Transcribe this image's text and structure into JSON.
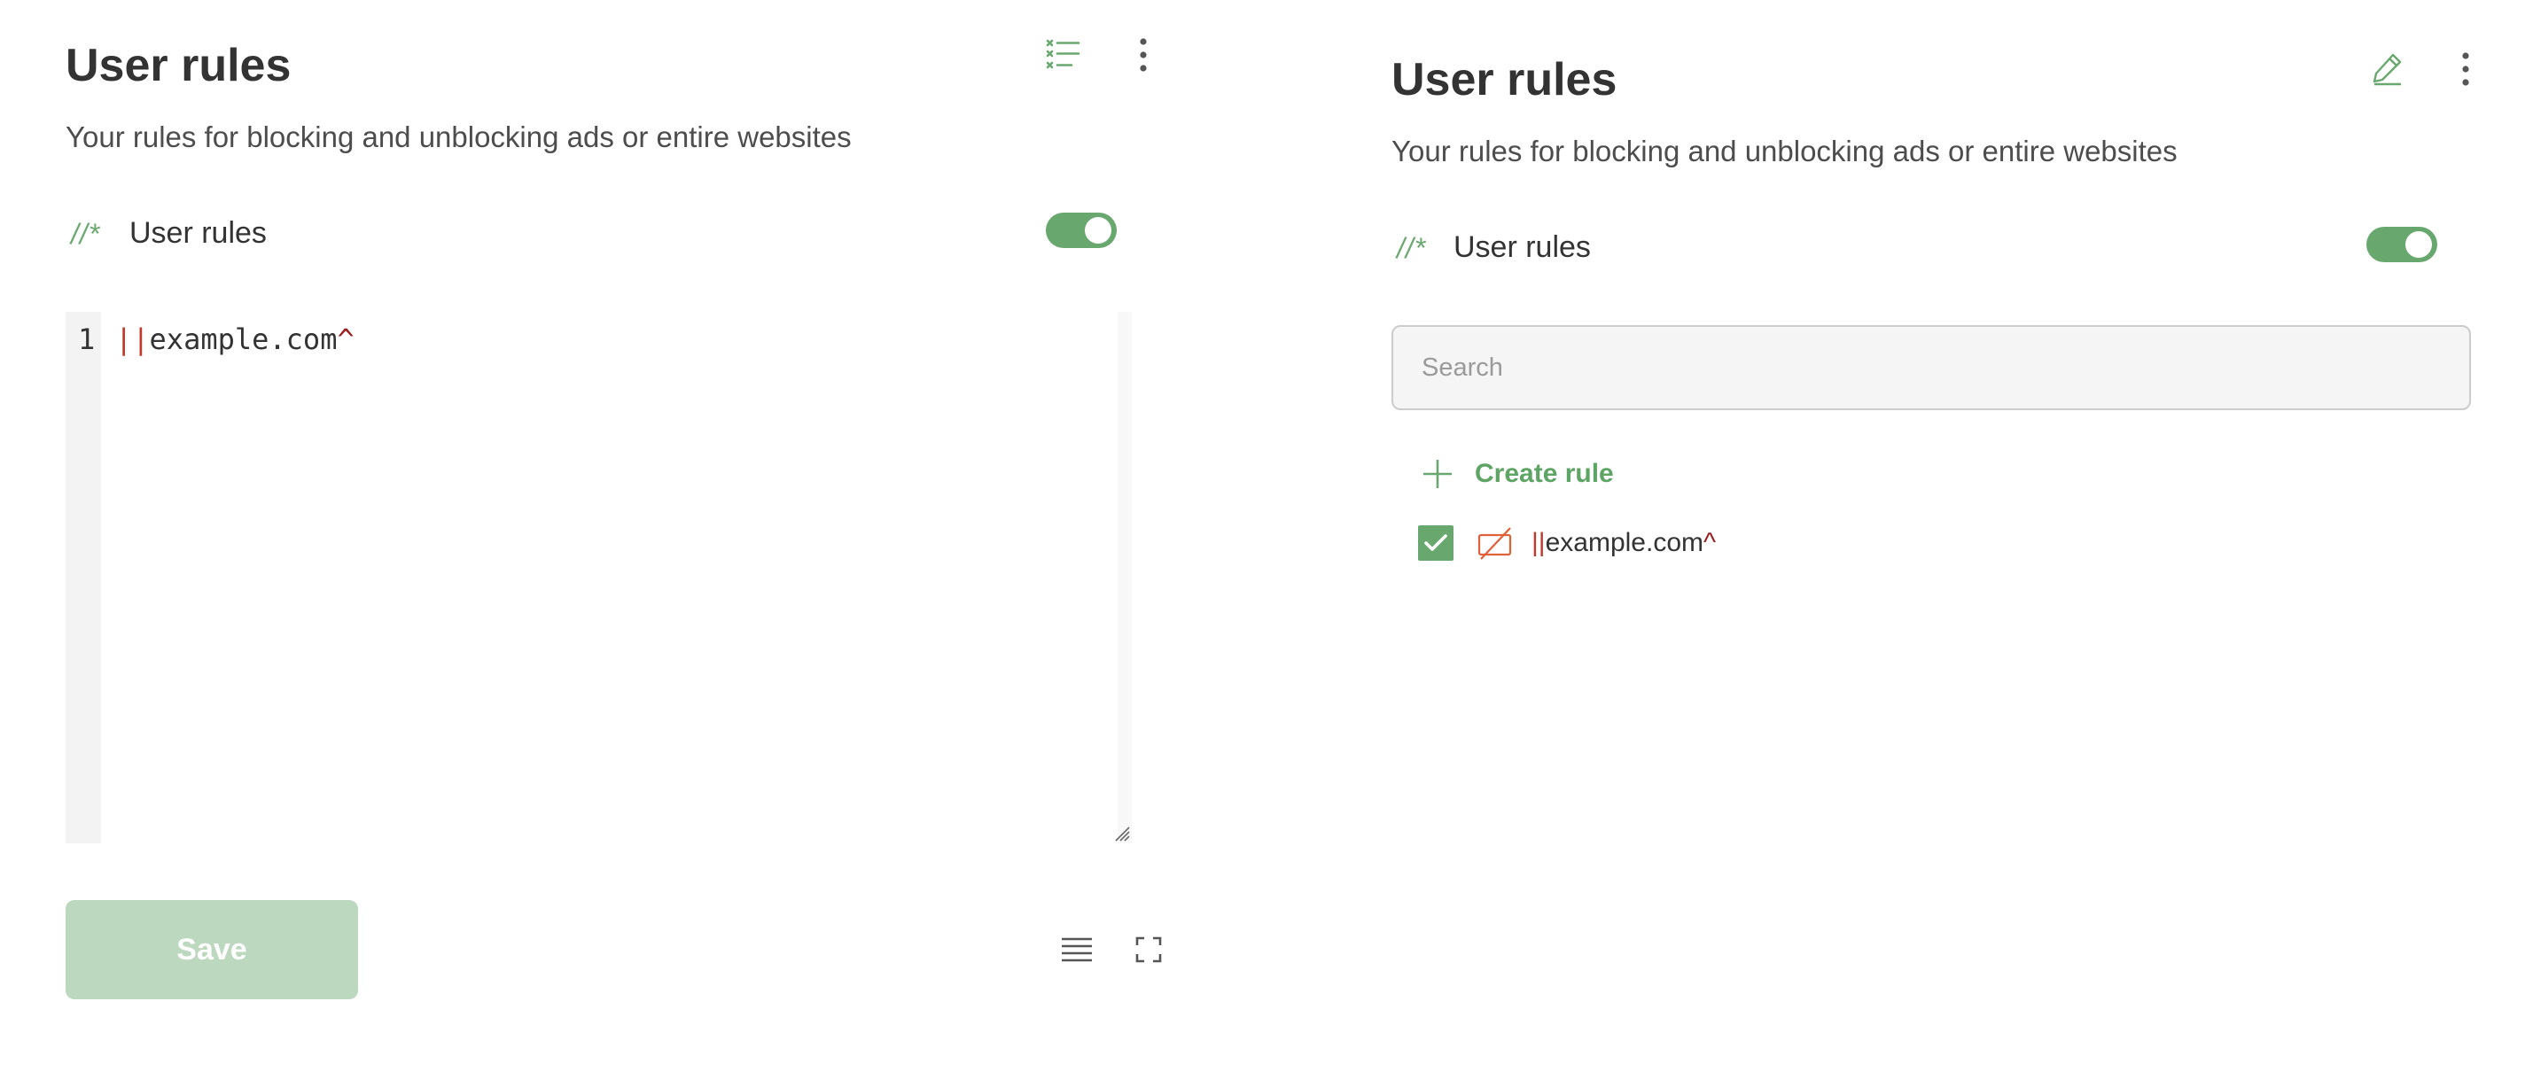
{
  "left_panel": {
    "title": "User rules",
    "subtitle": "Your rules for blocking and unblocking ads or entire websites",
    "header_icons": [
      "list-view-icon",
      "more-vertical-icon"
    ],
    "row_icon_glyph": "//*",
    "row_label": "User rules",
    "toggle_on": true,
    "editor": {
      "line_number": "1",
      "code_prefix": "||",
      "code_domain": "example.com",
      "code_suffix": "^"
    },
    "save_label": "Save",
    "footer_icons": [
      "wrap-lines-icon",
      "fullscreen-icon"
    ]
  },
  "right_panel": {
    "title": "User rules",
    "subtitle": "Your rules for blocking and unblocking ads or entire websites",
    "header_icons": [
      "edit-pencil-icon",
      "more-vertical-icon"
    ],
    "row_icon_glyph": "//*",
    "row_label": "User rules",
    "toggle_on": true,
    "search_placeholder": "Search",
    "create_rule_label": "Create rule",
    "rules": [
      {
        "enabled": true,
        "type_icon": "blocking-rule-icon",
        "prefix": "||",
        "domain": "example.com",
        "suffix": "^"
      }
    ]
  },
  "colors": {
    "accent_green": "#68a86e",
    "save_disabled": "#bcd8be",
    "rule_red": "#c0392b"
  }
}
